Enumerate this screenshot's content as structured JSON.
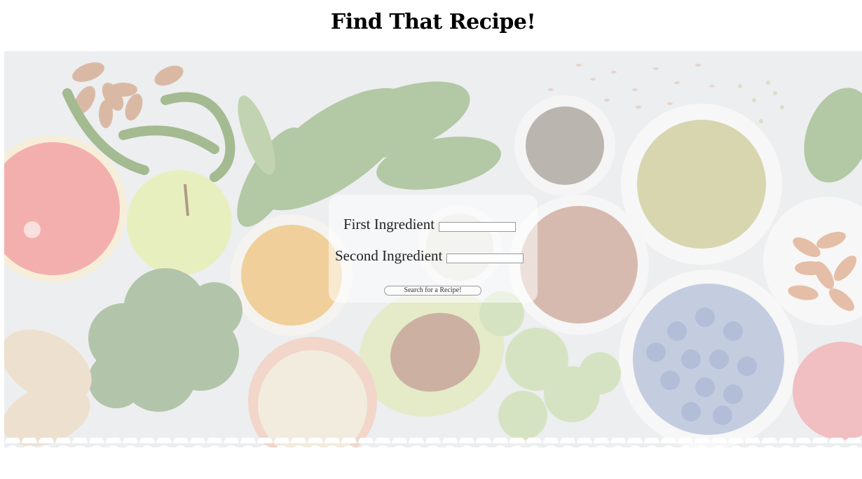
{
  "header": {
    "title": "Find That Recipe!"
  },
  "hero": {
    "image_description_icon": "vegetables-background-image"
  },
  "form": {
    "first_label": "First Ingredient",
    "first_value": "",
    "second_label": "Second Ingredient",
    "second_value": "",
    "search_label": "Search for a Recipe!"
  },
  "colors": {
    "background": "#ffffff",
    "overlay": "rgba(255,255,255,0.55)",
    "text": "#000000"
  }
}
